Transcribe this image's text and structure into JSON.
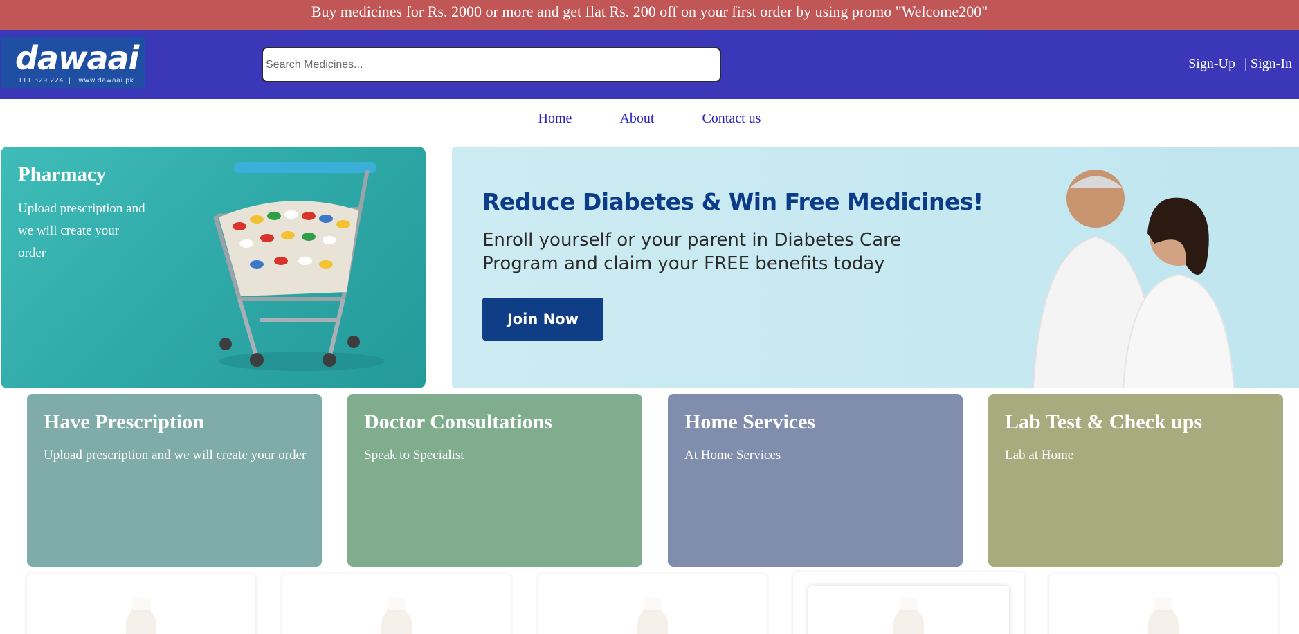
{
  "promo": {
    "text": "Buy medicines for Rs. 2000 or more and get flat Rs. 200 off on your first order by using promo \"Welcome200\""
  },
  "header": {
    "logo_text": "dawaai",
    "logo_sub": "111 329 224  |   www.dawaai.pk",
    "search_placeholder": "Search Medicines...",
    "signup": "Sign-Up",
    "signin": "| Sign-In"
  },
  "nav": {
    "items": [
      "Home",
      "About",
      "Contact us"
    ]
  },
  "pharmacy": {
    "title": "Pharmacy",
    "desc": "Upload prescription and we will create your order"
  },
  "banner": {
    "title": "Reduce Diabetes & Win Free Medicines!",
    "desc": "Enroll yourself or your parent in Diabetes Care Program and claim your FREE benefits today",
    "button": "Join Now"
  },
  "services": [
    {
      "title": "Have Prescription",
      "desc": "Upload prescription and we will create your order"
    },
    {
      "title": "Doctor Consultations",
      "desc": "Speak to Specialist"
    },
    {
      "title": "Home Services",
      "desc": "At Home Services"
    },
    {
      "title": "Lab Test & Check ups",
      "desc": "Lab at Home"
    }
  ],
  "colors": {
    "promo_bg": "#c05655",
    "header_bg": "#3a38b9",
    "nav_link": "#2a22b8",
    "banner_title": "#0c3b87",
    "join_button": "#0f3d86"
  }
}
